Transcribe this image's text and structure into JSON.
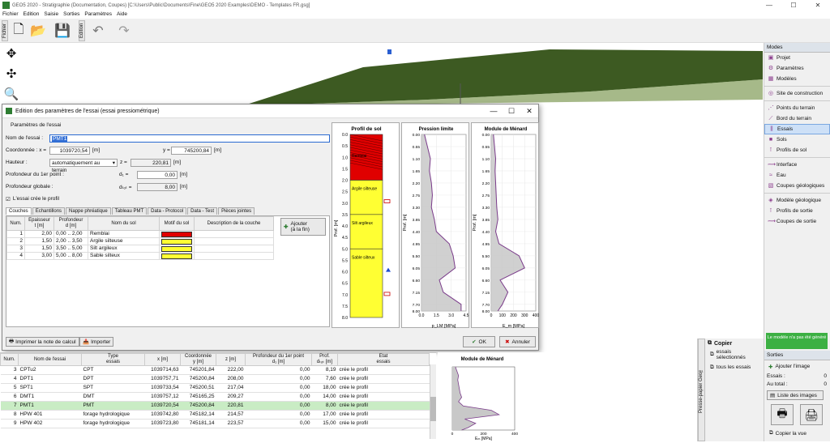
{
  "window": {
    "title": "GEO5 2020 - Stratigraphie (Documentation, Coupes) [C:\\Users\\Public\\Documents\\Fine\\GEO5 2020 Examples\\DEMO - Templates FR.gsg]",
    "controls": [
      "—",
      "☐",
      "✕"
    ]
  },
  "menu": [
    "Fichier",
    "Edition",
    "Saisie",
    "Sorties",
    "Paramètres",
    "Aide"
  ],
  "toolbar": {
    "file_tab": "Fichier",
    "edit_tab": "Edition"
  },
  "modes_panel": {
    "title": "Modes",
    "items": [
      {
        "label": "Projet",
        "icon": "project-icon"
      },
      {
        "label": "Paramètres",
        "icon": "settings-icon"
      },
      {
        "label": "Modèles",
        "icon": "models-icon"
      },
      {
        "label": "Site de construction",
        "icon": "site-icon"
      },
      {
        "label": "Points du terrain",
        "icon": "terrain-points-icon"
      },
      {
        "label": "Bord du terrain",
        "icon": "terrain-edge-icon"
      },
      {
        "label": "Essais",
        "icon": "tests-icon"
      },
      {
        "label": "Sols",
        "icon": "soils-icon"
      },
      {
        "label": "Profils de sol",
        "icon": "soil-profiles-icon"
      },
      {
        "label": "Interface",
        "icon": "interface-icon"
      },
      {
        "label": "Eau",
        "icon": "water-icon"
      },
      {
        "label": "Coupes géologiques",
        "icon": "geo-sections-icon"
      },
      {
        "label": "Modèle géologique",
        "icon": "geo-model-icon"
      },
      {
        "label": "Profils de sortie",
        "icon": "output-profiles-icon"
      },
      {
        "label": "Coupes de sortie",
        "icon": "output-sections-icon"
      }
    ],
    "active_index": 6
  },
  "dialog": {
    "title": "Edition des paramètres de l'essai (essai pressiométrique)",
    "group_title": "Paramètres de l'essai",
    "name_label": "Nom de l'essai :",
    "name_value": "PMT1",
    "coord_label": "Coordonnée : x =",
    "x_value": "1039720,54",
    "y_label": "y =",
    "y_value": "745200,84",
    "unit_m": "[m]",
    "height_label": "Hauteur :",
    "height_mode": "automatiquement au terrain",
    "z_label": "z =",
    "z_value": "220,81",
    "depth_label": "Profondeur du 1er point :",
    "d1_label": "d₁ =",
    "d1_value": "0,00",
    "global_depth_label": "Profondeur globale :",
    "dtot_label": "dₜₒₜ =",
    "dtot_value": "8,00",
    "create_profile_label": "L'essai crée le profil",
    "tabs": [
      "Couches",
      "Echantillons",
      "Nappe phréatique",
      "Tableau PMT",
      "Data - Protocol",
      "Data - Test",
      "Pièces jointes"
    ],
    "layers_headers": [
      "Num.",
      "Epaisseur\nt [m]",
      "Profondeur\nd [m]",
      "Nom du sol",
      "Motif du sol",
      "Description de la couche"
    ],
    "layers": [
      {
        "num": "1",
        "t": "2,00",
        "d": "0,00 .. 2,00",
        "soil": "Remblai",
        "color": "#e00000"
      },
      {
        "num": "2",
        "t": "1,50",
        "d": "2,00 .. 3,50",
        "soil": "Argile silteuse",
        "color": "#ffff33"
      },
      {
        "num": "3",
        "t": "1,50",
        "d": "3,50 .. 5,00",
        "soil": "Silt argileux",
        "color": "#ffff33"
      },
      {
        "num": "4",
        "t": "3,00",
        "d": "5,00 .. 8,00",
        "soil": "Sable silteux",
        "color": "#ffff33"
      }
    ],
    "add_button": "Ajouter\n(à la fin)",
    "print_button": "Imprimer la note de calcul",
    "import_button": "Importer",
    "ok_button": "OK",
    "cancel_button": "Annuler",
    "profile_title": "Profil de sol",
    "profile_axis": "Prof. [m]",
    "profile_ticks": [
      "0.0",
      "0.5",
      "1.0",
      "1.5",
      "2.0",
      "2.5",
      "3.0",
      "3.5",
      "4.0",
      "4.5",
      "5.0",
      "5.5",
      "6.0",
      "6.5",
      "7.0",
      "7.5",
      "8.0"
    ],
    "profile_layer_labels": [
      "Remblai",
      "Argile silteuse",
      "Silt argileux",
      "Sable silteux"
    ]
  },
  "chart_data": [
    {
      "type": "area",
      "title": "Pression limite",
      "ylabel": "Prof. [m]",
      "xlabel": "p_LM [MPa]",
      "xlim": [
        0,
        4.5
      ],
      "xticks": [
        "0.0",
        "1.5",
        "3.0",
        "4.5"
      ],
      "yticks": [
        "0.00",
        "0.55",
        "1.10",
        "1.65",
        "2.20",
        "2.75",
        "3.30",
        "3.85",
        "4.40",
        "4.95",
        "5.50",
        "6.05",
        "6.60",
        "7.15",
        "7.70",
        "8.00"
      ],
      "ylim": [
        0,
        8
      ],
      "depth": [
        0,
        0.55,
        1.1,
        1.65,
        2.2,
        2.75,
        3.3,
        3.85,
        4.4,
        4.95,
        5.5,
        6.05,
        6.6,
        7.15,
        7.7,
        8.0
      ],
      "values": [
        0.3,
        0.6,
        0.9,
        0.8,
        1.0,
        1.1,
        1.0,
        1.3,
        1.5,
        2.8,
        3.2,
        3.4,
        1.8,
        2.2,
        4.0,
        4.0
      ]
    },
    {
      "type": "area",
      "title": "Module de Ménard",
      "ylabel": "Prof. [m]",
      "xlabel": "E_m [MPa]",
      "xlim": [
        0,
        400
      ],
      "xticks": [
        "0",
        "100",
        "200",
        "300",
        "400"
      ],
      "yticks": [
        "0.00",
        "0.55",
        "1.10",
        "1.65",
        "2.20",
        "2.75",
        "3.30",
        "3.85",
        "4.40",
        "4.95",
        "5.50",
        "6.05",
        "6.60",
        "7.15",
        "7.70",
        "8.00"
      ],
      "ylim": [
        0,
        8
      ],
      "depth": [
        0,
        0.55,
        1.1,
        1.65,
        2.2,
        2.75,
        3.3,
        3.85,
        4.4,
        4.95,
        5.5,
        6.05,
        6.6,
        7.15,
        7.7,
        8.0
      ],
      "values": [
        20,
        30,
        40,
        35,
        40,
        45,
        50,
        60,
        40,
        70,
        250,
        300,
        80,
        150,
        100,
        60
      ]
    }
  ],
  "bottom_table": {
    "headers": [
      "Num.",
      "Nom de l'essai",
      "Type\nessais",
      "x [m]",
      "Coordonnée\ny [m]",
      "z [m]",
      "Profondeur du 1er point\nd₁ [m]",
      "Prof.\ndₜₒₜ [m]",
      "Etat\nessais"
    ],
    "rows": [
      {
        "num": "3",
        "name": "CPTu2",
        "type": "CPT",
        "x": "1039714,63",
        "y": "745201,84",
        "z": "222,00",
        "d1": "0,00",
        "dtot": "8,19",
        "state": "crée le profil"
      },
      {
        "num": "4",
        "name": "DPT1",
        "type": "DPT",
        "x": "1039757,71",
        "y": "745200,84",
        "z": "208,00",
        "d1": "0,00",
        "dtot": "7,60",
        "state": "crée le profil"
      },
      {
        "num": "5",
        "name": "SPT1",
        "type": "SPT",
        "x": "1039733,54",
        "y": "745200,51",
        "z": "217,04",
        "d1": "0,00",
        "dtot": "18,00",
        "state": "crée le profil"
      },
      {
        "num": "6",
        "name": "DMT1",
        "type": "DMT",
        "x": "1039757,12",
        "y": "745165,25",
        "z": "209,27",
        "d1": "0,00",
        "dtot": "14,00",
        "state": "crée le profil"
      },
      {
        "num": "7",
        "name": "PMT1",
        "type": "PMT",
        "x": "1039720,54",
        "y": "745200,84",
        "z": "220,81",
        "d1": "0,00",
        "dtot": "8,00",
        "state": "crée le profil",
        "selected": true
      },
      {
        "num": "8",
        "name": "HPW 401",
        "type": "forage hydrologique",
        "x": "1039742,80",
        "y": "745182,14",
        "z": "214,57",
        "d1": "0,00",
        "dtot": "17,00",
        "state": "crée le profil"
      },
      {
        "num": "9",
        "name": "HPW 402",
        "type": "forage hydrologique",
        "x": "1039723,80",
        "y": "745181,14",
        "z": "223,57",
        "d1": "0,00",
        "dtot": "15,00",
        "state": "crée le profil"
      }
    ]
  },
  "bottom_chart": {
    "title": "Module de Ménard",
    "xlabel": "Eₘ [MPa]"
  },
  "copier": {
    "title": "Copier",
    "selected_tests": "essais sélectionnés",
    "all_tests": "tous les essais",
    "side_tab": "Presse-papier Geo™"
  },
  "outputs": {
    "model_note": "Le modèle n'a pas été généré",
    "title": "Sorties",
    "add_image": "Ajouter l'image",
    "tests_label": "Essais :",
    "tests_value": "0",
    "total_label": "Au total :",
    "total_value": "0",
    "image_list": "Liste des images",
    "copy_view": "Copier la vue"
  },
  "colors": {
    "selected_row": "#c9ecc4",
    "accent": "#7aa7e0",
    "profile_red": "#e00000",
    "profile_yellow": "#ffff33",
    "plot_fill": "#c8c8c8",
    "plot_line": "#7a3b8a"
  }
}
